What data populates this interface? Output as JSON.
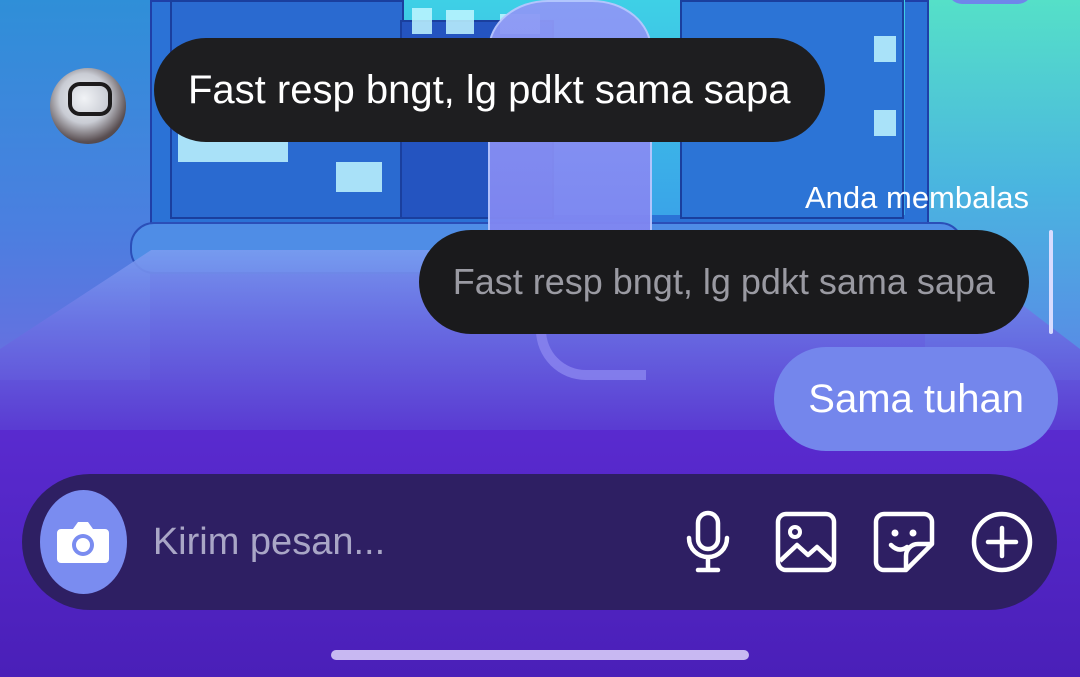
{
  "conversation": {
    "incoming_message": "Fast resp bngt, lg pdkt sama sapa",
    "reply_label": "Anda membalas",
    "reply_quote": "Fast resp bngt, lg pdkt sama sapa",
    "outgoing_message": "Sama tuhan"
  },
  "composer": {
    "placeholder": "Kirim pesan..."
  },
  "colors": {
    "incoming_bubble": "#1e1e20",
    "outgoing_bubble": "#7486ec",
    "composer_bg": "#2e1f63",
    "camera_button": "#7a8cf0"
  },
  "icons": {
    "camera": "camera-icon",
    "microphone": "microphone-icon",
    "gallery": "image-icon",
    "sticker": "sticker-icon",
    "add": "plus-circle-icon"
  }
}
